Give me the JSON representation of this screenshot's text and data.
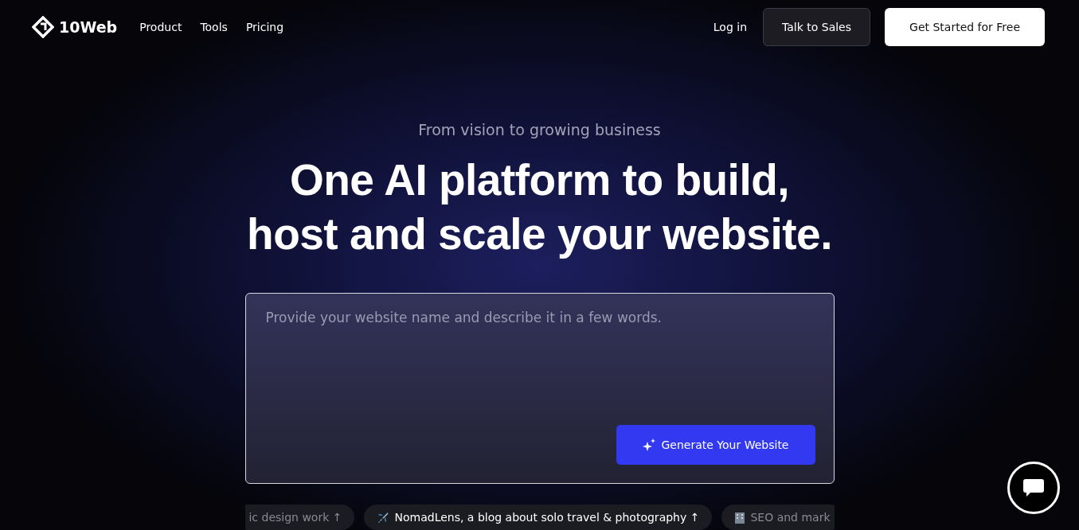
{
  "nav": {
    "brand": "10Web",
    "links": [
      "Product",
      "Tools",
      "Pricing"
    ],
    "login": "Log in",
    "sales": "Talk to Sales",
    "cta": "Get Started for Free"
  },
  "hero": {
    "eyebrow": "From vision to growing business",
    "title_lines": [
      "One AI platform to build,",
      "host and scale your website."
    ]
  },
  "prompt": {
    "placeholder": "Provide your website name and describe it in a few words.",
    "button": "Generate Your Website"
  },
  "examples": [
    {
      "kind": "plain",
      "text": "ic design work ↑"
    },
    {
      "kind": "plane",
      "text": "NomadLens, a blog about solo travel & photography ↑"
    },
    {
      "kind": "building",
      "text": "SEO and mark"
    }
  ]
}
